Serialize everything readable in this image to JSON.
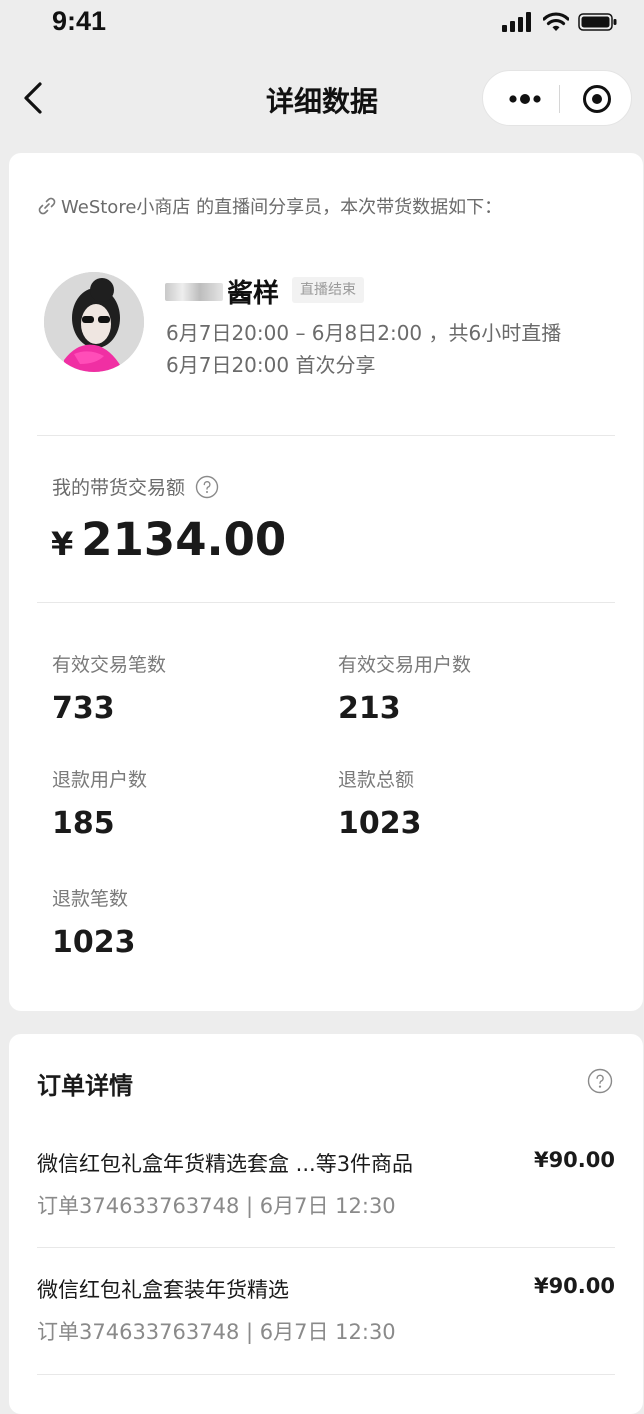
{
  "status_bar": {
    "time": "9:41"
  },
  "nav": {
    "title": "详细数据"
  },
  "intro": {
    "text": "WeStore小商店 的直播间分享员，本次带货数据如下："
  },
  "streamer": {
    "name_suffix": "酱样",
    "badge": "直播结束",
    "time_range": "6月7日20:00 – 6月8日2:00 ，共6小时直播",
    "first_share": "6月7日20:00 首次分享"
  },
  "gmv": {
    "label": "我的带货交易额",
    "currency": "¥",
    "value": "2134.00"
  },
  "metrics": [
    {
      "label": "有效交易笔数",
      "value": "733"
    },
    {
      "label": "有效交易用户数",
      "value": "213"
    },
    {
      "label": "退款用户数",
      "value": "185"
    },
    {
      "label": "退款总额",
      "value": "1023"
    },
    {
      "label": "退款笔数",
      "value": "1023"
    }
  ],
  "orders": {
    "title": "订单详情",
    "items": [
      {
        "product": "微信红包礼盒年货精选套盒 ...等3件商品",
        "price": "¥90.00",
        "meta": "订单374633763748 | 6月7日 12:30"
      },
      {
        "product": "微信红包礼盒套装年货精选",
        "price": "¥90.00",
        "meta": "订单374633763748 | 6月7日 12:30"
      }
    ]
  },
  "colors": {
    "background": "#ededed",
    "card": "#ffffff",
    "primary_text": "#1a1a1a",
    "secondary_text": "#7a7a7a"
  },
  "icons": [
    "back-icon",
    "more-icon",
    "close-target-icon",
    "link-icon",
    "question-icon",
    "signal-icon",
    "wifi-icon",
    "battery-icon"
  ]
}
